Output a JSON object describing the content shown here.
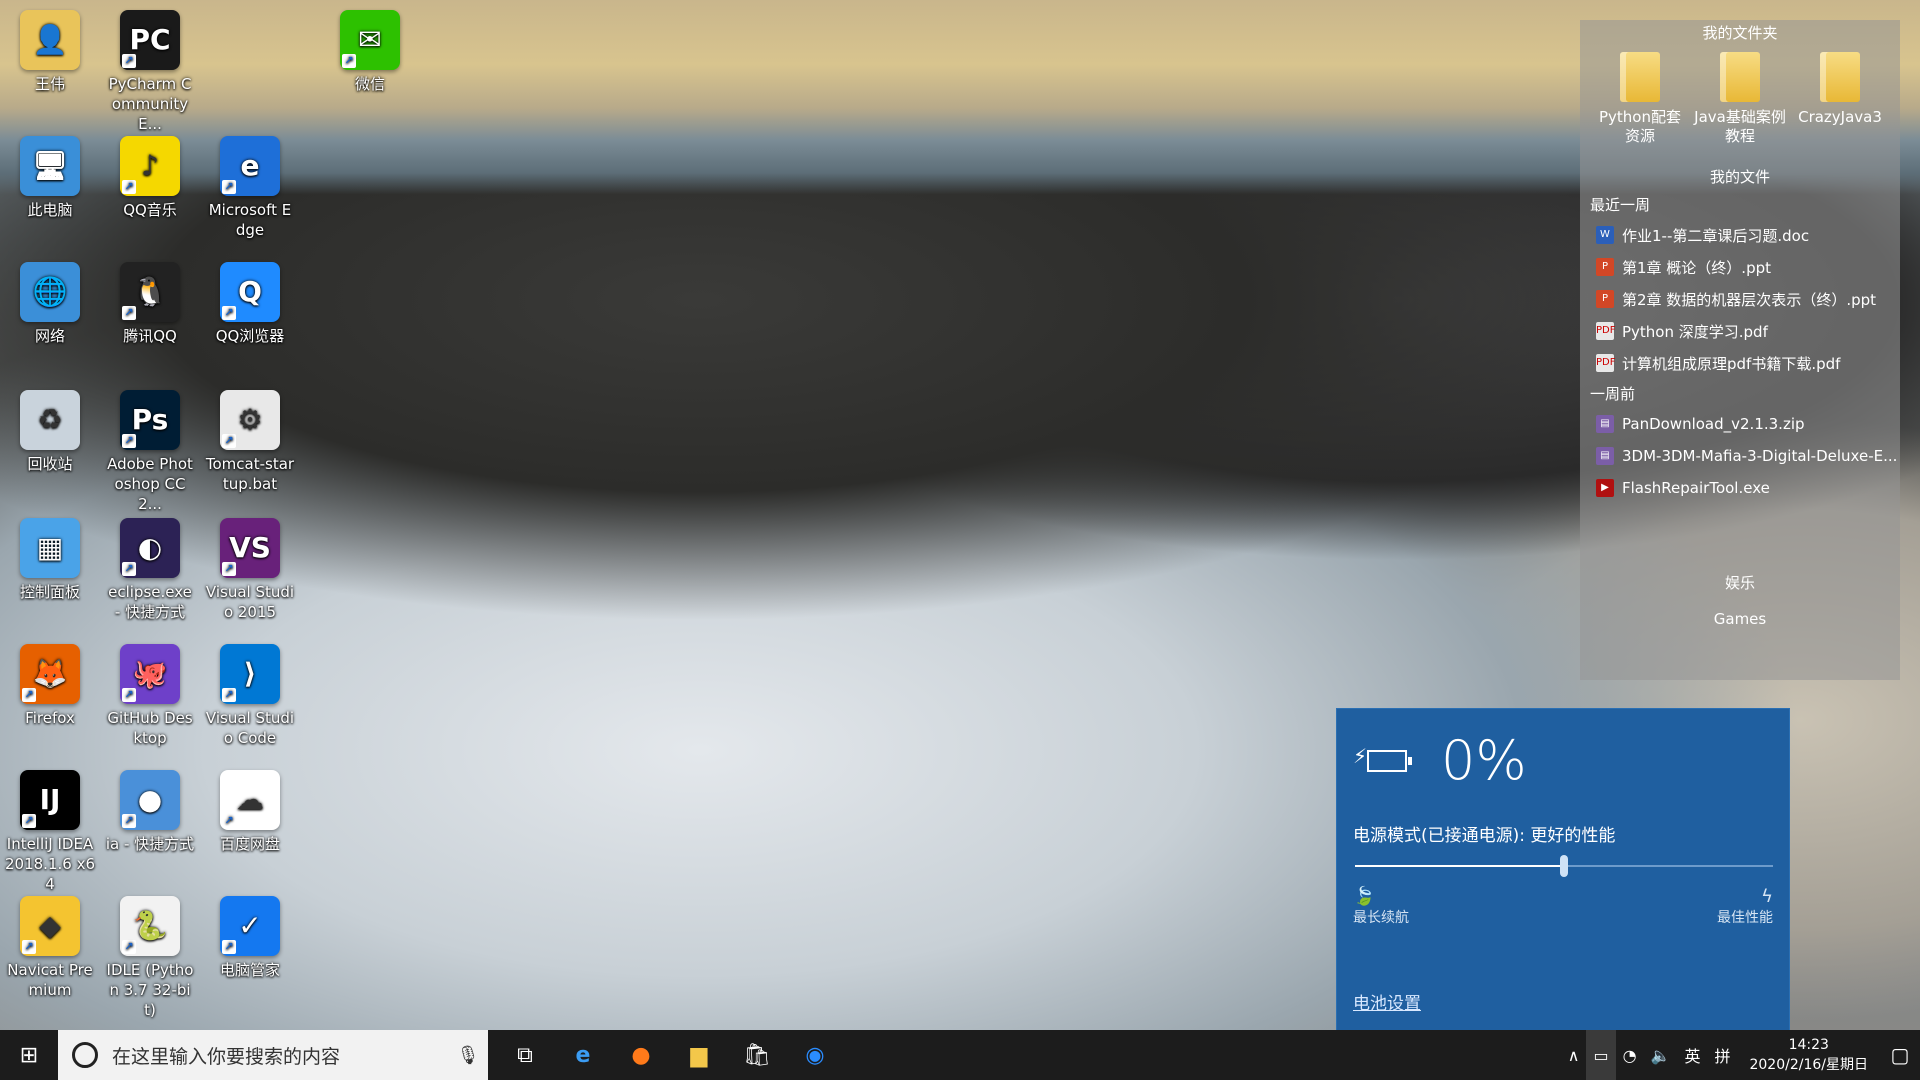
{
  "desktop": {
    "icons": [
      {
        "label": "王伟",
        "name": "user-folder-icon",
        "color": "#e9c45a",
        "glyph": "👤"
      },
      {
        "label": "PyCharm Community E...",
        "name": "pycharm-icon",
        "color": "#1a1a1a",
        "glyph": "PC"
      },
      {
        "label": "微信",
        "name": "wechat-icon",
        "color": "#2dc100",
        "glyph": "✉"
      },
      {
        "label": "此电脑",
        "name": "this-pc-icon",
        "color": "#3a8fd8",
        "glyph": "🖥"
      },
      {
        "label": "QQ音乐",
        "name": "qq-music-icon",
        "color": "#f5d800",
        "glyph": "♪"
      },
      {
        "label": "Microsoft Edge",
        "name": "edge-icon",
        "color": "#1e6fd8",
        "glyph": "e"
      },
      {
        "label": "网络",
        "name": "network-icon",
        "color": "#3b8fd8",
        "glyph": "🌐"
      },
      {
        "label": "腾讯QQ",
        "name": "qq-icon",
        "color": "#222222",
        "glyph": "🐧"
      },
      {
        "label": "QQ浏览器",
        "name": "qq-browser-icon",
        "color": "#1f8bff",
        "glyph": "Q"
      },
      {
        "label": "回收站",
        "name": "recycle-bin-icon",
        "color": "#c9d3dc",
        "glyph": "♻"
      },
      {
        "label": "Adobe Photoshop CC 2...",
        "name": "photoshop-icon",
        "color": "#001d34",
        "glyph": "Ps"
      },
      {
        "label": "Tomcat-startup.bat",
        "name": "bat-file-icon",
        "color": "#e8e8e8",
        "glyph": "⚙"
      },
      {
        "label": "控制面板",
        "name": "control-panel-icon",
        "color": "#4aa3e8",
        "glyph": "▦"
      },
      {
        "label": "eclipse.exe - 快捷方式",
        "name": "eclipse-icon",
        "color": "#2c2255",
        "glyph": "◐"
      },
      {
        "label": "Visual Studio 2015",
        "name": "visual-studio-icon",
        "color": "#68217a",
        "glyph": "VS"
      },
      {
        "label": "Firefox",
        "name": "firefox-icon",
        "color": "#e66000",
        "glyph": "🦊"
      },
      {
        "label": "GitHub Desktop",
        "name": "github-desktop-icon",
        "color": "#6e40c9",
        "glyph": "🐙"
      },
      {
        "label": "Visual Studio Code",
        "name": "vscode-icon",
        "color": "#0078d4",
        "glyph": "⟩"
      },
      {
        "label": "IntelliJ IDEA 2018.1.6 x64",
        "name": "intellij-icon",
        "color": "#000000",
        "glyph": "IJ"
      },
      {
        "label": "ia - 快捷方式",
        "name": "ia-shortcut-icon",
        "color": "#4a90d9",
        "glyph": "●"
      },
      {
        "label": "百度网盘",
        "name": "baidu-netdisk-icon",
        "color": "#ffffff",
        "glyph": "☁"
      },
      {
        "label": "Navicat Premium",
        "name": "navicat-icon",
        "color": "#f4c430",
        "glyph": "◆"
      },
      {
        "label": "IDLE (Python 3.7 32-bit)",
        "name": "python-idle-icon",
        "color": "#f2f2f2",
        "glyph": "🐍"
      },
      {
        "label": "电脑管家",
        "name": "pc-manager-icon",
        "color": "#1478f0",
        "glyph": "✓"
      }
    ]
  },
  "fence": {
    "my_folder_title": "我的文件夹",
    "folders": [
      {
        "label": "Python配套资源"
      },
      {
        "label": "Java基础案例教程"
      },
      {
        "label": "CrazyJava3"
      }
    ],
    "my_files_title": "我的文件",
    "recent_week_title": "最近一周",
    "recent_files": [
      {
        "label": "作业1--第二章课后习题.doc",
        "type": "doc"
      },
      {
        "label": "第1章 概论（终）.ppt",
        "type": "ppt"
      },
      {
        "label": "第2章 数据的机器层次表示（终）.ppt",
        "type": "ppt"
      },
      {
        "label": "Python 深度学习.pdf",
        "type": "pdf"
      },
      {
        "label": "计算机组成原理pdf书籍下载.pdf",
        "type": "pdf"
      }
    ],
    "week_ago_title": "一周前",
    "older_files": [
      {
        "label": "PanDownload_v2.1.3.zip",
        "type": "zip"
      },
      {
        "label": "3DM-3DM-Mafia-3-Digital-Deluxe-E...",
        "type": "zip"
      },
      {
        "label": "FlashRepairTool.exe",
        "type": "exe"
      }
    ],
    "entertainment_title": "娱乐",
    "games_title": "Games"
  },
  "battery_flyout": {
    "percent": "0%",
    "power_mode": "电源模式(已接通电源): 更好的性能",
    "slider_value": 0.5,
    "left_label": "最长续航",
    "right_label": "最佳性能",
    "settings_link": "电池设置"
  },
  "taskbar": {
    "search_placeholder": "在这里输入你要搜索的内容",
    "ime_lang": "英",
    "ime_mode": "拼",
    "time": "14:23",
    "date": "2020/2/16/星期日"
  },
  "colors": {
    "flyout_bg": "#1f5fa0",
    "taskbar_bg": "#1c1c1c",
    "fence_bg": "rgba(150,150,150,0.55)"
  }
}
